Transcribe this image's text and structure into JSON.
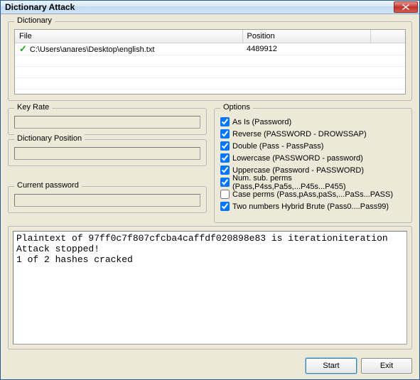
{
  "window": {
    "title": "Dictionary Attack"
  },
  "dictionary": {
    "legend": "Dictionary",
    "columns": {
      "file": "File",
      "position": "Position"
    },
    "rows": [
      {
        "file": "C:\\Users\\anares\\Desktop\\english.txt",
        "position": "4489912",
        "ok": true
      }
    ]
  },
  "keyrate": {
    "legend": "Key Rate",
    "value": ""
  },
  "dictpos": {
    "legend": "Dictionary Position",
    "value": ""
  },
  "curpass": {
    "legend": "Current password",
    "value": ""
  },
  "options": {
    "legend": "Options",
    "items": [
      {
        "label": "As Is (Password)",
        "checked": true
      },
      {
        "label": "Reverse (PASSWORD - DROWSSAP)",
        "checked": true
      },
      {
        "label": "Double (Pass - PassPass)",
        "checked": true
      },
      {
        "label": "Lowercase (PASSWORD - password)",
        "checked": true
      },
      {
        "label": "Uppercase (Password - PASSWORD)",
        "checked": true
      },
      {
        "label": "Num. sub. perms (Pass,P4ss,Pa5s,...P45s...P455)",
        "checked": true
      },
      {
        "label": "Case perms (Pass,pAss,paSs,...PaSs...PASS)",
        "checked": false
      },
      {
        "label": "Two numbers Hybrid Brute (Pass0....Pass99)",
        "checked": true
      }
    ]
  },
  "log": {
    "lines": [
      "Plaintext of 97ff0c7f807cfcba4caffdf020898e83 is iterationiteration",
      "Attack stopped!",
      "1 of 2 hashes cracked"
    ]
  },
  "buttons": {
    "start": "Start",
    "exit": "Exit"
  }
}
